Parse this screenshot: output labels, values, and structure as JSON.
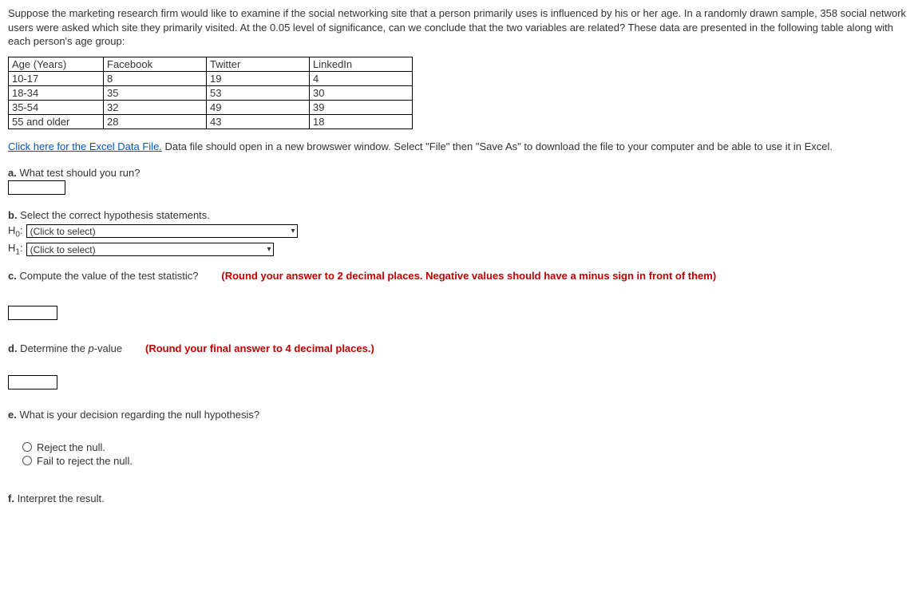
{
  "intro": "Suppose the marketing research firm would like to examine if the social networking site that a person primarily uses is influenced by his or her age. In a randomly drawn sample, 358 social network users were asked which site they primarily visited. At the 0.05 level of significance, can we conclude that the two variables are related? These data are presented in the following table along with each person's age group:",
  "table": {
    "headers": [
      "Age (Years)",
      "Facebook",
      "Twitter",
      "LinkedIn"
    ],
    "rows": [
      [
        "10-17",
        "8",
        "19",
        "4"
      ],
      [
        "18-34",
        "35",
        "53",
        "30"
      ],
      [
        "35-54",
        "32",
        "49",
        "39"
      ],
      [
        "55 and older",
        "28",
        "43",
        "18"
      ]
    ]
  },
  "datafile": {
    "link_text": "Click here for the Excel Data File.",
    "after_text": " Data file should open in a new browswer window. Select \"File\" then \"Save As\" to download the file to your computer and be able to use it in Excel."
  },
  "qa": {
    "a_prefix": "a.",
    "a_text": " What test should you run?",
    "b_prefix": "b.",
    "b_text": " Select the correct hypothesis statements.",
    "h0_label": "H",
    "h0_sub": "0",
    "h1_label": "H",
    "h1_sub": "1",
    "select_placeholder": "(Click to select)",
    "c_prefix": "c.",
    "c_text": " Compute the value of the test statistic?",
    "c_hint": "(Round your answer to 2 decimal places. Negative values should have a minus sign in front of them)",
    "d_prefix": "d.",
    "d_text": " Determine the ",
    "d_pvalue": "p",
    "d_text2": "-value",
    "d_hint": "(Round your final answer to 4 decimal places.)",
    "e_prefix": "e.",
    "e_text": " What is your decision regarding the null hypothesis?",
    "e_opt1": "Reject the null.",
    "e_opt2": "Fail to reject the null.",
    "f_prefix": "f.",
    "f_text": " Interpret the result."
  },
  "chart_data": {
    "type": "table",
    "title": "Social network site by age group",
    "categories": [
      "10-17",
      "18-34",
      "35-54",
      "55 and older"
    ],
    "series": [
      {
        "name": "Facebook",
        "values": [
          8,
          35,
          32,
          28
        ]
      },
      {
        "name": "Twitter",
        "values": [
          19,
          53,
          49,
          43
        ]
      },
      {
        "name": "LinkedIn",
        "values": [
          4,
          30,
          39,
          18
        ]
      }
    ]
  }
}
